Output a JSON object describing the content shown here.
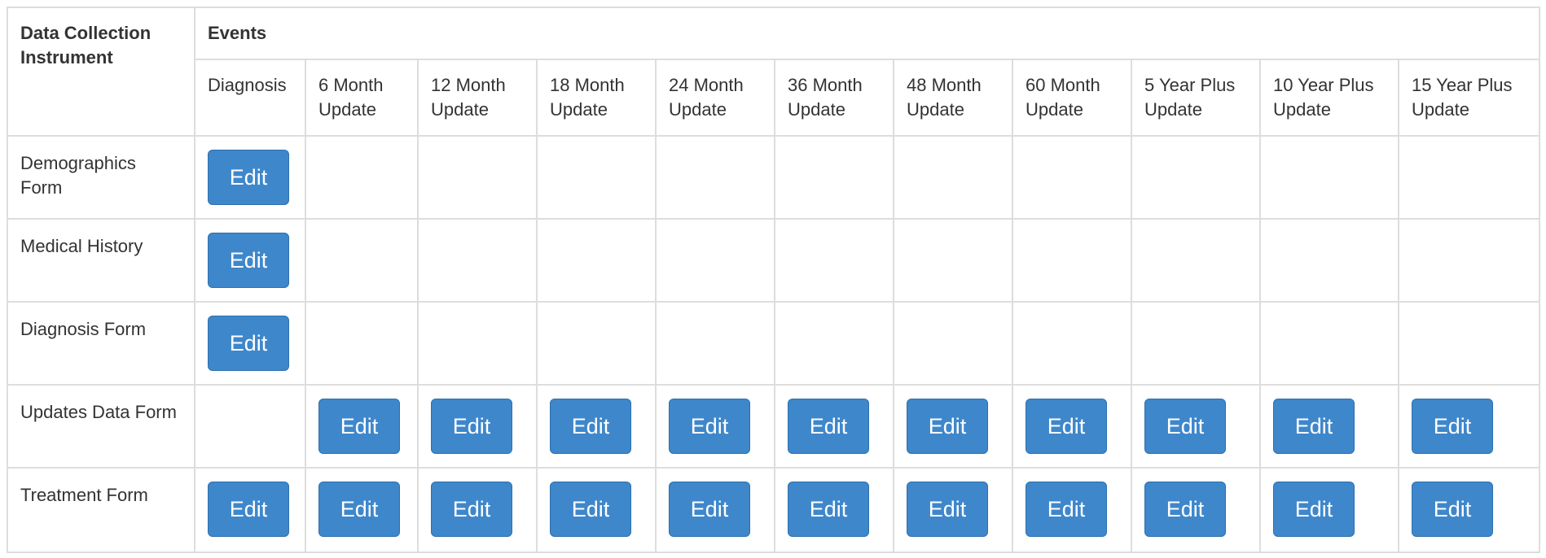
{
  "header": {
    "instrument_label": "Data Collection Instrument",
    "events_label": "Events"
  },
  "events": [
    "Diagnosis",
    "6 Month Update",
    "12 Month Update",
    "18 Month Update",
    "24 Month Update",
    "36 Month Update",
    "48 Month Update",
    "60 Month Update",
    "5 Year Plus Update",
    "10 Year Plus Update",
    "15 Year Plus Update"
  ],
  "edit_label": "Edit",
  "rows": [
    {
      "label": "Demographics Form",
      "cells": [
        true,
        false,
        false,
        false,
        false,
        false,
        false,
        false,
        false,
        false,
        false
      ]
    },
    {
      "label": "Medical History",
      "cells": [
        true,
        false,
        false,
        false,
        false,
        false,
        false,
        false,
        false,
        false,
        false
      ]
    },
    {
      "label": "Diagnosis Form",
      "cells": [
        true,
        false,
        false,
        false,
        false,
        false,
        false,
        false,
        false,
        false,
        false
      ]
    },
    {
      "label": "Updates Data Form",
      "cells": [
        false,
        true,
        true,
        true,
        true,
        true,
        true,
        true,
        true,
        true,
        true
      ]
    },
    {
      "label": "Treatment Form",
      "cells": [
        true,
        true,
        true,
        true,
        true,
        true,
        true,
        true,
        true,
        true,
        true
      ]
    }
  ],
  "colors": {
    "button_bg": "#3f87cb",
    "button_text": "#ffffff",
    "border": "#dddddd"
  }
}
